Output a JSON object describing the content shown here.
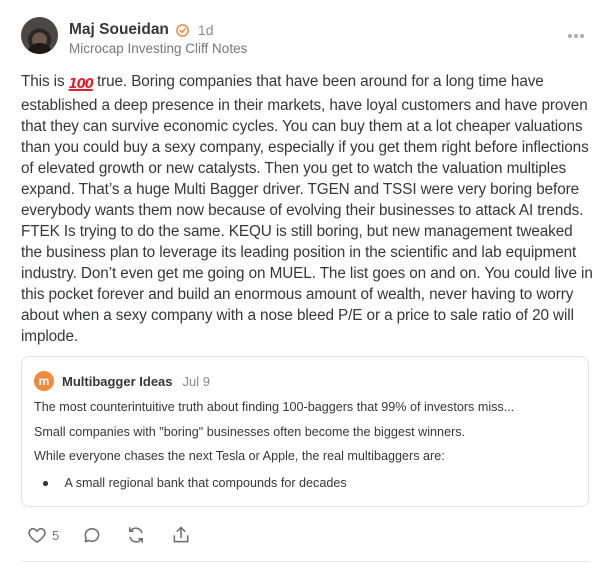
{
  "author": {
    "name": "Maj Soueidan",
    "time": "1d",
    "publication": "Microcap Investing Cliff Notes"
  },
  "post": {
    "intro": "This is",
    "emoji_icon": "hundred-points-emoji",
    "emoji_text": "100",
    "body": " true. Boring companies that have been around for a long time have established a deep presence in their markets, have loyal customers and have proven that they can survive economic cycles. You can buy them at a lot cheaper valuations than you could buy a sexy company, especially if you get them right before inflections of elevated growth or new catalysts. Then you get to watch the valuation multiples expand. That’s a huge Multi Bagger driver. TGEN and TSSI were very boring before everybody wants them now because of evolving their businesses to attack AI trends. FTEK Is trying to do the same. KEQU is still boring, but new management tweaked the business plan to leverage its leading position in the scientific and lab equipment industry. Don’t even get me going on MUEL. The list goes on and on. You could live in this pocket forever and build an enormous amount of wealth, never having to worry about when a sexy company with a nose bleed P/E or a price to sale ratio of 20 will implode."
  },
  "quoted_note": {
    "logo_letter": "m",
    "name": "Multibagger Ideas",
    "date": "Jul 9",
    "lines": [
      "The most counterintuitive truth about finding 100-baggers that 99% of investors miss...",
      "Small companies with \"boring\" businesses often become the biggest winners.",
      "While everyone chases the next Tesla or Apple, the real multibaggers are:"
    ],
    "bullet": "A small regional bank that compounds for decades"
  },
  "actions": {
    "like_count": "5",
    "icons": [
      "heart-icon",
      "comment-icon",
      "restack-icon",
      "share-icon"
    ]
  },
  "colors": {
    "verified": "#f08a3c",
    "publication_logo": "#f08a3c",
    "text": "#363737",
    "muted": "#777777"
  }
}
